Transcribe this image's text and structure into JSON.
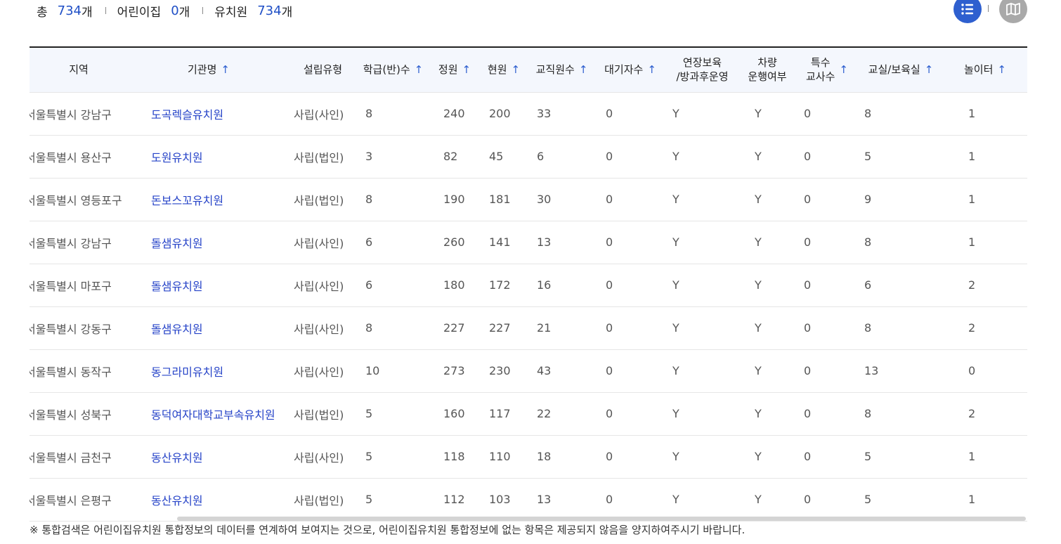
{
  "summary": {
    "total_label": "총",
    "total_count": "734",
    "total_unit": "개",
    "daycare_label": "어린이집",
    "daycare_count": "0",
    "daycare_unit": "개",
    "kinder_label": "유치원",
    "kinder_count": "734",
    "kinder_unit": "개"
  },
  "view_toggle": {
    "list_icon": "list-icon",
    "map_icon": "map-icon"
  },
  "colors": {
    "accent": "#2e5fcf",
    "link": "#2744c8",
    "header_bg": "#f4f7fd"
  },
  "table": {
    "headers": [
      {
        "label": "지역"
      },
      {
        "label": "기관명",
        "sort": "↑"
      },
      {
        "label": "설립유형"
      },
      {
        "label": "학급(반)수",
        "sort": "↑"
      },
      {
        "label": "정원",
        "sort": "↑"
      },
      {
        "label": "현원",
        "sort": "↑"
      },
      {
        "label": "교직원수",
        "sort": "↑"
      },
      {
        "label": "대기자수",
        "sort": "↑"
      },
      {
        "label": "연장보육",
        "label2": "/방과후운영"
      },
      {
        "label": "차량",
        "label2": "운행여부"
      },
      {
        "label": "특수",
        "label2": "교사수",
        "sort": "↑"
      },
      {
        "label": "교실/보육실",
        "sort": "↑"
      },
      {
        "label": "놀이터",
        "sort": "↑"
      }
    ],
    "rows": [
      [
        "서울특별시 강남구",
        "도곡렉슬유치원",
        "사립(사인)",
        "8",
        "240",
        "200",
        "33",
        "0",
        "Y",
        "Y",
        "0",
        "8",
        "1"
      ],
      [
        "서울특별시 용산구",
        "도원유치원",
        "사립(법인)",
        "3",
        "82",
        "45",
        "6",
        "0",
        "Y",
        "Y",
        "0",
        "5",
        "1"
      ],
      [
        "서울특별시 영등포구",
        "돈보스꼬유치원",
        "사립(법인)",
        "8",
        "190",
        "181",
        "30",
        "0",
        "Y",
        "Y",
        "0",
        "9",
        "1"
      ],
      [
        "서울특별시 강남구",
        "돌샘유치원",
        "사립(사인)",
        "6",
        "260",
        "141",
        "13",
        "0",
        "Y",
        "Y",
        "0",
        "8",
        "1"
      ],
      [
        "서울특별시 마포구",
        "돌샘유치원",
        "사립(사인)",
        "6",
        "180",
        "172",
        "16",
        "0",
        "Y",
        "Y",
        "0",
        "6",
        "2"
      ],
      [
        "서울특별시 강동구",
        "돌샘유치원",
        "사립(사인)",
        "8",
        "227",
        "227",
        "21",
        "0",
        "Y",
        "Y",
        "0",
        "8",
        "2"
      ],
      [
        "서울특별시 동작구",
        "동그라미유치원",
        "사립(사인)",
        "10",
        "273",
        "230",
        "43",
        "0",
        "Y",
        "Y",
        "0",
        "13",
        "0"
      ],
      [
        "서울특별시 성북구",
        "동덕여자대학교부속유치원",
        "사립(법인)",
        "5",
        "160",
        "117",
        "22",
        "0",
        "Y",
        "Y",
        "0",
        "8",
        "2"
      ],
      [
        "서울특별시 금천구",
        "동산유치원",
        "사립(사인)",
        "5",
        "118",
        "110",
        "18",
        "0",
        "Y",
        "Y",
        "0",
        "5",
        "1"
      ],
      [
        "서울특별시 은평구",
        "동산유치원",
        "사립(법인)",
        "5",
        "112",
        "103",
        "13",
        "0",
        "Y",
        "Y",
        "0",
        "5",
        "1"
      ]
    ]
  },
  "notice": "※ 통합검색은 어린이집유치원 통합정보의 데이터를 연계하여 보여지는 것으로, 어린이집유치원 통합정보에 없는 항목은 제공되지 않음을 양지하여주시기 바랍니다."
}
